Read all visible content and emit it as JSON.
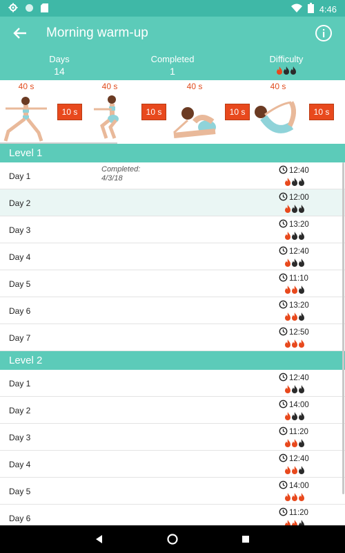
{
  "status": {
    "time": "4:46"
  },
  "appbar": {
    "title": "Morning warm-up"
  },
  "stats": {
    "days_label": "Days",
    "days_value": "14",
    "completed_label": "Completed",
    "completed_value": "1",
    "difficulty_label": "Difficulty",
    "difficulty_level": 1
  },
  "exercises": [
    {
      "duration": "40 s",
      "rest": "10 s"
    },
    {
      "duration": "40 s",
      "rest": "10 s"
    },
    {
      "duration": "40 s",
      "rest": "10 s"
    },
    {
      "duration": "40 s",
      "rest": "10 s"
    }
  ],
  "levels": [
    {
      "label": "Level 1",
      "days": [
        {
          "day": "Day 1",
          "completed": "Completed:\n4/3/18",
          "time": "12:40",
          "flames": 1
        },
        {
          "day": "Day 2",
          "completed": "",
          "time": "12:00",
          "flames": 1
        },
        {
          "day": "Day 3",
          "completed": "",
          "time": "13:20",
          "flames": 1
        },
        {
          "day": "Day 4",
          "completed": "",
          "time": "12:40",
          "flames": 1
        },
        {
          "day": "Day 5",
          "completed": "",
          "time": "11:10",
          "flames": 2
        },
        {
          "day": "Day 6",
          "completed": "",
          "time": "13:20",
          "flames": 2
        },
        {
          "day": "Day 7",
          "completed": "",
          "time": "12:50",
          "flames": 3
        }
      ]
    },
    {
      "label": "Level 2",
      "days": [
        {
          "day": "Day 1",
          "completed": "",
          "time": "12:40",
          "flames": 1
        },
        {
          "day": "Day 2",
          "completed": "",
          "time": "14:00",
          "flames": 1
        },
        {
          "day": "Day 3",
          "completed": "",
          "time": "11:20",
          "flames": 2
        },
        {
          "day": "Day 4",
          "completed": "",
          "time": "12:40",
          "flames": 2
        },
        {
          "day": "Day 5",
          "completed": "",
          "time": "14:00",
          "flames": 3
        },
        {
          "day": "Day 6",
          "completed": "",
          "time": "11:20",
          "flames": 2
        }
      ]
    }
  ],
  "colors": {
    "accent": "#5ccbb9",
    "status": "#3fb8a7",
    "flame_active": "#e8491d",
    "flame_inactive": "#2b2b2b",
    "rest": "#e8491d"
  },
  "icons": {
    "status_left": [
      "gear-icon",
      "circle-icon",
      "sd-card-icon"
    ],
    "status_right": [
      "wifi-icon",
      "battery-icon"
    ],
    "back": "arrow-left-icon",
    "info": "info-icon",
    "clock": "clock-icon",
    "flame": "flame-icon"
  }
}
